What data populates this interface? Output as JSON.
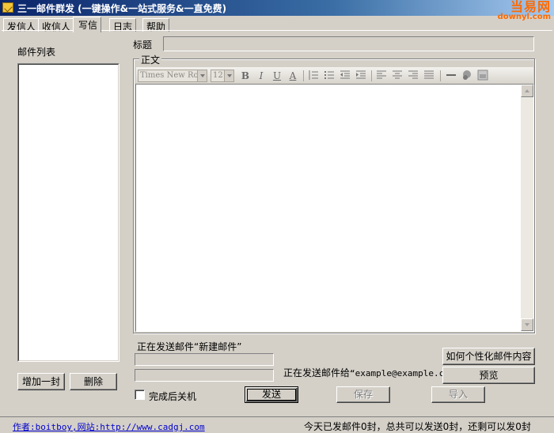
{
  "window": {
    "title": "三一邮件群发 (一键操作&一站式服务&一直免费)",
    "icon": "envelope-icon"
  },
  "watermark": {
    "line1": "当易网",
    "line2": "downyl.com"
  },
  "tabs": [
    {
      "label": "发信人",
      "active": false
    },
    {
      "label": "收信人",
      "active": false
    },
    {
      "label": "写信",
      "active": true
    },
    {
      "label": "日志",
      "active": false
    },
    {
      "label": "帮助",
      "active": false
    }
  ],
  "left_panel": {
    "list_label": "邮件列表",
    "add_button": "增加一封",
    "delete_button": "删除"
  },
  "compose": {
    "subject_label": "标题",
    "subject_value": "",
    "body_group_label": "正文",
    "font_name": "Times New Rom",
    "font_size": "12",
    "toolbar_icons": [
      "bold-icon",
      "italic-icon",
      "underline-icon",
      "font-color-icon",
      "ordered-list-icon",
      "unordered-list-icon",
      "outdent-icon",
      "indent-icon",
      "align-left-icon",
      "align-center-icon",
      "align-right-icon",
      "justify-icon",
      "horizontal-rule-icon",
      "insert-link-icon",
      "insert-image-icon"
    ],
    "toolbar_glyphs": {
      "bold": "B",
      "italic": "I",
      "underline": "U",
      "font_color": "A"
    }
  },
  "sending": {
    "sending_mail_label": "正在发送邮件“新建邮件”",
    "sending_to_prefix": "正在发送邮件给",
    "sending_to_address": "“example@example.com”",
    "shutdown_label": "完成后关机",
    "shutdown_checked": false
  },
  "buttons": {
    "personalize": "如何个性化邮件内容",
    "preview": "预览",
    "send": "发送",
    "save": "保存",
    "import": "导入"
  },
  "status": {
    "author_prefix": "作者",
    "author_text": ":boitboy,网站:http://www.cadgj.com",
    "summary": "今天已发邮件0封，总共可以发送0封，还剩可以发0封"
  }
}
